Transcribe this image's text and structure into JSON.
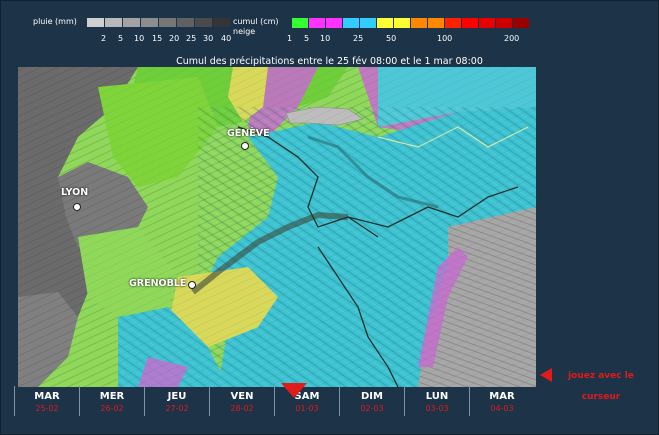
{
  "legend": {
    "rain": {
      "label": "pluie (mm)",
      "ticks": [
        "2",
        "5",
        "10",
        "15",
        "20",
        "25",
        "30",
        "40"
      ],
      "colors": [
        "#cfcfcf",
        "#b9b9b9",
        "#a3a3a3",
        "#8d8d8d",
        "#777777",
        "#616161",
        "#4b4b4b",
        "#353535"
      ]
    },
    "snow": {
      "label_line1": "cumul (cm)",
      "label_line2": "neige",
      "ticks": [
        "1",
        "5",
        "10",
        "25",
        "50",
        "100",
        "200"
      ],
      "colors": [
        "#33ff33",
        "#ff33ff",
        "#ff33ff",
        "#33ccff",
        "#33ccff",
        "#ffff33",
        "#ffff33",
        "#ff8800",
        "#ff8800",
        "#ff2200",
        "#ff0000",
        "#e60000",
        "#cc0000",
        "#990000"
      ]
    }
  },
  "map": {
    "title": "Cumul des précipitations entre le 25 fév 08:00 et le 1 mar 08:00",
    "cities": [
      "GENÈVE",
      "LYON",
      "GRENOBLE"
    ],
    "colors": {
      "rain": "#6b6b6b",
      "snow_light": "#7fd43a",
      "snow_mid": "#3ec3d2",
      "snow_heavy": "#d8d85a",
      "snow_pink": "#c86bd0",
      "plain": "#9c9c9c"
    }
  },
  "timeline": {
    "days": [
      {
        "name": "MAR",
        "date": "25-02"
      },
      {
        "name": "MER",
        "date": "26-02"
      },
      {
        "name": "JEU",
        "date": "27-02"
      },
      {
        "name": "VEN",
        "date": "28-02"
      },
      {
        "name": "SAM",
        "date": "01-03"
      },
      {
        "name": "DIM",
        "date": "02-03"
      },
      {
        "name": "LUN",
        "date": "03-03"
      },
      {
        "name": "MAR",
        "date": "04-03"
      }
    ],
    "selected_index": 4
  },
  "hint": {
    "text_line1": "jouez avec le",
    "text_line2": "curseur"
  }
}
